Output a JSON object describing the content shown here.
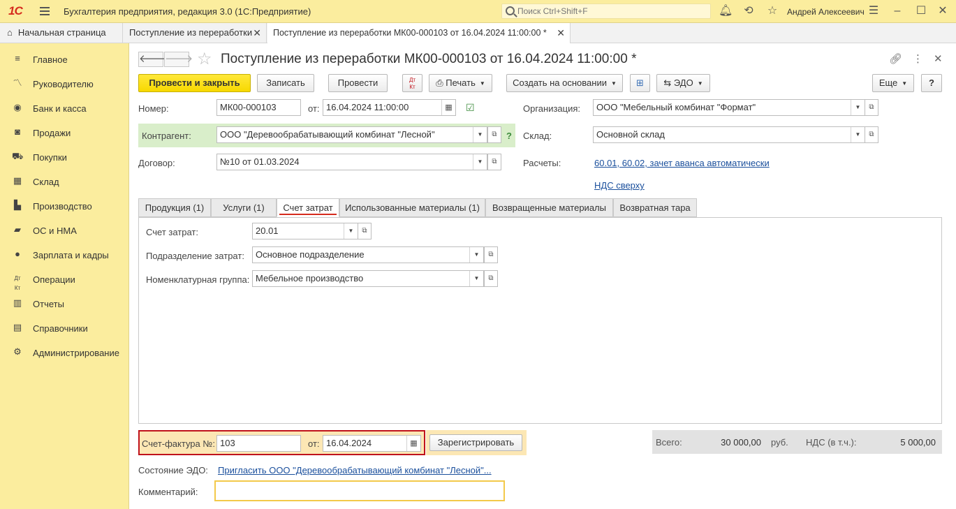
{
  "app": {
    "logo": "1С",
    "title": "Бухгалтерия предприятия, редакция 3.0  (1С:Предприятие)",
    "search_placeholder": "Поиск Ctrl+Shift+F",
    "user": "Андрей Алексеевич"
  },
  "tabs": {
    "home": "Начальная страница",
    "tab1": "Поступление из переработки",
    "tab2": "Поступление из переработки МК00-000103 от 16.04.2024 11:00:00 *"
  },
  "sidebar": {
    "items": [
      {
        "label": "Главное",
        "icon": "menu-icon"
      },
      {
        "label": "Руководителю",
        "icon": "chart-line-icon"
      },
      {
        "label": "Банк и касса",
        "icon": "coin-icon"
      },
      {
        "label": "Продажи",
        "icon": "bag-icon"
      },
      {
        "label": "Покупки",
        "icon": "cart-icon"
      },
      {
        "label": "Склад",
        "icon": "warehouse-icon"
      },
      {
        "label": "Производство",
        "icon": "factory-icon"
      },
      {
        "label": "ОС и НМА",
        "icon": "truck-icon"
      },
      {
        "label": "Зарплата и кадры",
        "icon": "person-icon"
      },
      {
        "label": "Операции",
        "icon": "dt-kt-icon"
      },
      {
        "label": "Отчеты",
        "icon": "bar-chart-icon"
      },
      {
        "label": "Справочники",
        "icon": "book-icon"
      },
      {
        "label": "Администрирование",
        "icon": "gear-icon"
      }
    ]
  },
  "doc": {
    "title": "Поступление из переработки МК00-000103 от 16.04.2024 11:00:00 *"
  },
  "toolbar": {
    "post_close": "Провести и закрыть",
    "save": "Записать",
    "post": "Провести",
    "dtkt": "Дт Кт",
    "print": "Печать",
    "create_based": "Создать на основании",
    "edo": "ЭДО",
    "more": "Еще",
    "help": "?"
  },
  "form": {
    "number_label": "Номер:",
    "number_value": "МК00-000103",
    "date_label": "от:",
    "date_value": "16.04.2024 11:00:00",
    "org_label": "Организация:",
    "org_value": "ООО \"Мебельный комбинат \"Формат\"",
    "contractor_label": "Контрагент:",
    "contractor_value": "ООО \"Деревообрабатывающий комбинат \"Лесной\"",
    "contractor_help": "?",
    "warehouse_label": "Склад:",
    "warehouse_value": "Основной склад",
    "contract_label": "Договор:",
    "contract_value": "№10 от 01.03.2024",
    "settlements_label": "Расчеты:",
    "settlements_link": "60.01, 60.02, зачет аванса автоматически",
    "vat_link": "НДС сверху"
  },
  "form_tabs": [
    "Продукция (1)",
    "Услуги (1)",
    "Счет затрат",
    "Использованные материалы (1)",
    "Возвращенные материалы",
    "Возвратная тара"
  ],
  "cost_tab": {
    "account_label": "Счет затрат:",
    "account_value": "20.01",
    "division_label": "Подразделение затрат:",
    "division_value": "Основное подразделение",
    "group_label": "Номенклатурная группа:",
    "group_value": "Мебельное производство"
  },
  "invoice": {
    "label": "Счет-фактура №:",
    "number": "103",
    "date_label": "от:",
    "date": "16.04.2024",
    "register": "Зарегистрировать"
  },
  "totals": {
    "total_label": "Всего:",
    "total_value": "30 000,00",
    "currency": "руб.",
    "vat_label": "НДС (в т.ч.):",
    "vat_value": "5 000,00"
  },
  "edo": {
    "label": "Состояние ЭДО:",
    "link": "Пригласить  ООО \"Деревообрабатывающий комбинат \"Лесной\"..."
  },
  "comment": {
    "label": "Комментарий:",
    "value": ""
  },
  "colors": {
    "sidebar_bg": "#fbed9e",
    "primary_button": "#f7d800",
    "contractor_highlight": "#d9eeca",
    "invoice_border": "#c0121b",
    "link": "#1a4f9c"
  }
}
